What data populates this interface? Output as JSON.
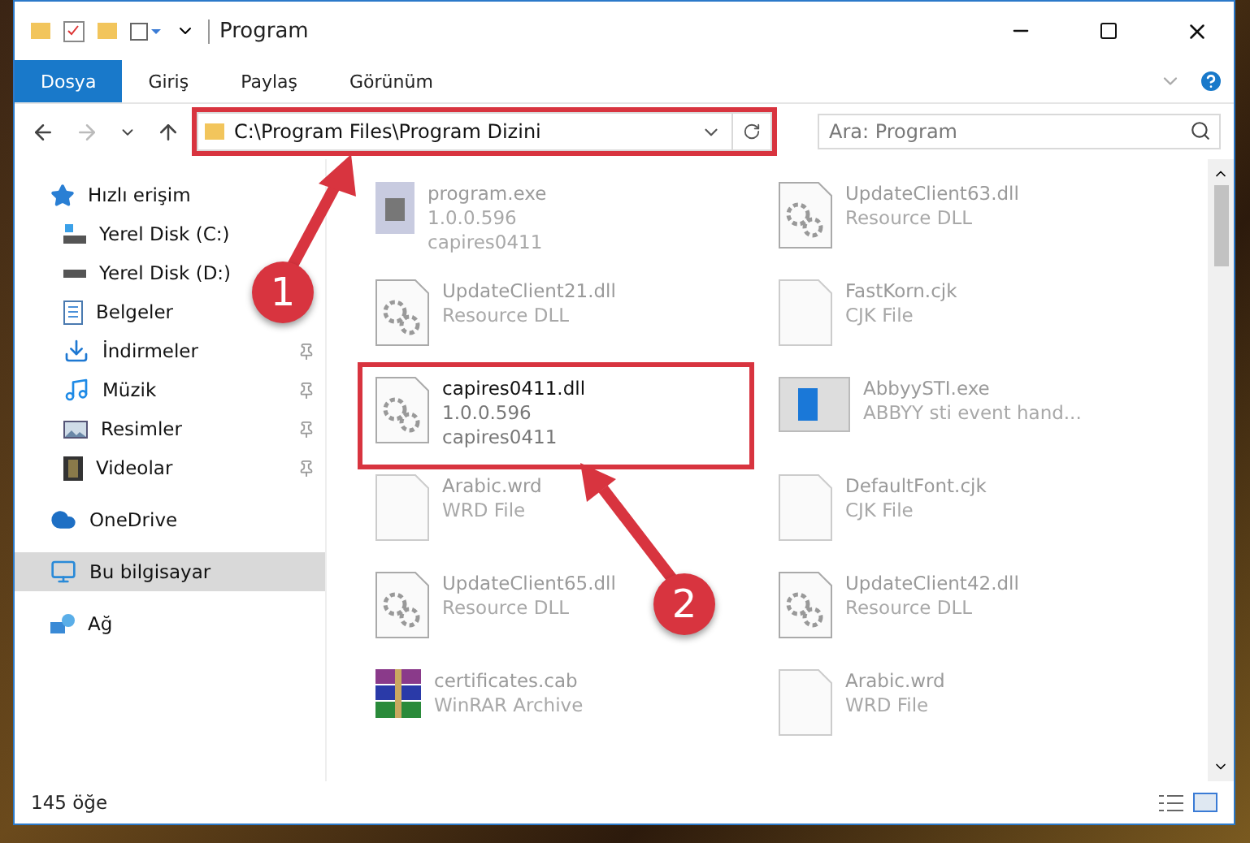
{
  "window": {
    "title": "Program"
  },
  "ribbon_tabs": [
    {
      "label": "Dosya",
      "kind": "file"
    },
    {
      "label": "Giriş",
      "kind": "tab"
    },
    {
      "label": "Paylaş",
      "kind": "tab"
    },
    {
      "label": "Görünüm",
      "kind": "tab"
    }
  ],
  "address_bar": {
    "path": "C:\\Program Files\\Program Dizini",
    "highlighted": true
  },
  "search": {
    "placeholder": "Ara: Program"
  },
  "sidebar": {
    "items": [
      {
        "label": "Hızlı erişim",
        "pinned": false,
        "selected": false,
        "children": [
          {
            "label": "Yerel Disk (C:)",
            "pinned": false,
            "selected": false
          },
          {
            "label": "Yerel Disk (D:)",
            "pinned": false,
            "selected": false
          },
          {
            "label": "Belgeler",
            "pinned": false,
            "selected": false
          },
          {
            "label": "İndirmeler",
            "pinned": true,
            "selected": false
          },
          {
            "label": "Müzik",
            "pinned": true,
            "selected": false
          },
          {
            "label": "Resimler",
            "pinned": true,
            "selected": false
          },
          {
            "label": "Videolar",
            "pinned": true,
            "selected": false
          }
        ]
      },
      {
        "label": "OneDrive",
        "pinned": false,
        "selected": false
      },
      {
        "label": "Bu bilgisayar",
        "pinned": false,
        "selected": true
      },
      {
        "label": "Ağ",
        "pinned": false,
        "selected": false
      }
    ]
  },
  "files": [
    {
      "name": "program.exe",
      "lines": [
        "1.0.0.596",
        "capires0411"
      ],
      "highlighted": false
    },
    {
      "name": "UpdateClient63.dll",
      "lines": [
        "Resource DLL"
      ],
      "highlighted": false
    },
    {
      "name": "UpdateClient21.dll",
      "lines": [
        "Resource DLL"
      ],
      "highlighted": false
    },
    {
      "name": "FastKorn.cjk",
      "lines": [
        "CJK File"
      ],
      "highlighted": false
    },
    {
      "name": "capires0411.dll",
      "lines": [
        "1.0.0.596",
        "capires0411"
      ],
      "highlighted": true
    },
    {
      "name": "AbbyySTI.exe",
      "lines": [
        "ABBYY sti event hand..."
      ],
      "highlighted": false
    },
    {
      "name": "Arabic.wrd",
      "lines": [
        "WRD File"
      ],
      "highlighted": false
    },
    {
      "name": "DefaultFont.cjk",
      "lines": [
        "CJK File"
      ],
      "highlighted": false
    },
    {
      "name": "UpdateClient65.dll",
      "lines": [
        "Resource DLL"
      ],
      "highlighted": false
    },
    {
      "name": "UpdateClient42.dll",
      "lines": [
        "Resource DLL"
      ],
      "highlighted": false
    },
    {
      "name": "certificates.cab",
      "lines": [
        "WinRAR Archive"
      ],
      "highlighted": false
    },
    {
      "name": "Arabic.wrd",
      "lines": [
        "WRD File"
      ],
      "highlighted": false
    }
  ],
  "status_bar": {
    "count": "145 öğe"
  },
  "annotations": [
    {
      "number": "1"
    },
    {
      "number": "2"
    }
  ]
}
